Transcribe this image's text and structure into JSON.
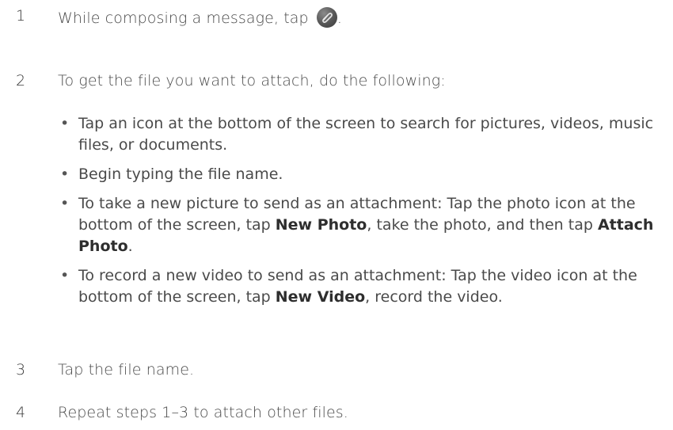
{
  "steps": [
    {
      "num": "1",
      "text_before_icon": "While composing a message, tap ",
      "text_after_icon": ".",
      "icon": "paperclip-icon"
    },
    {
      "num": "2",
      "text": "To get the file you want to attach, do the following:"
    },
    {
      "num": "3",
      "text": "Tap the file name."
    },
    {
      "num": "4",
      "text": "Repeat steps 1–3 to attach other files."
    }
  ],
  "bullets": [
    {
      "text": "Tap an icon at the bottom of the screen to search for pictures, videos, music files, or documents."
    },
    {
      "text": "Begin typing the file name."
    },
    {
      "part1": "To take a new picture to send as an attachment: Tap the photo icon at the bottom of the screen, tap ",
      "bold1": "New Photo",
      "part2": ", take the photo, and then tap ",
      "bold2": "Attach Photo",
      "part3": "."
    },
    {
      "part1": "To record a new video to send as an attachment: Tap the video icon at the bottom of the screen, tap ",
      "bold1": "New Video",
      "part2": ", record the video."
    }
  ],
  "bullet_symbol": "•"
}
